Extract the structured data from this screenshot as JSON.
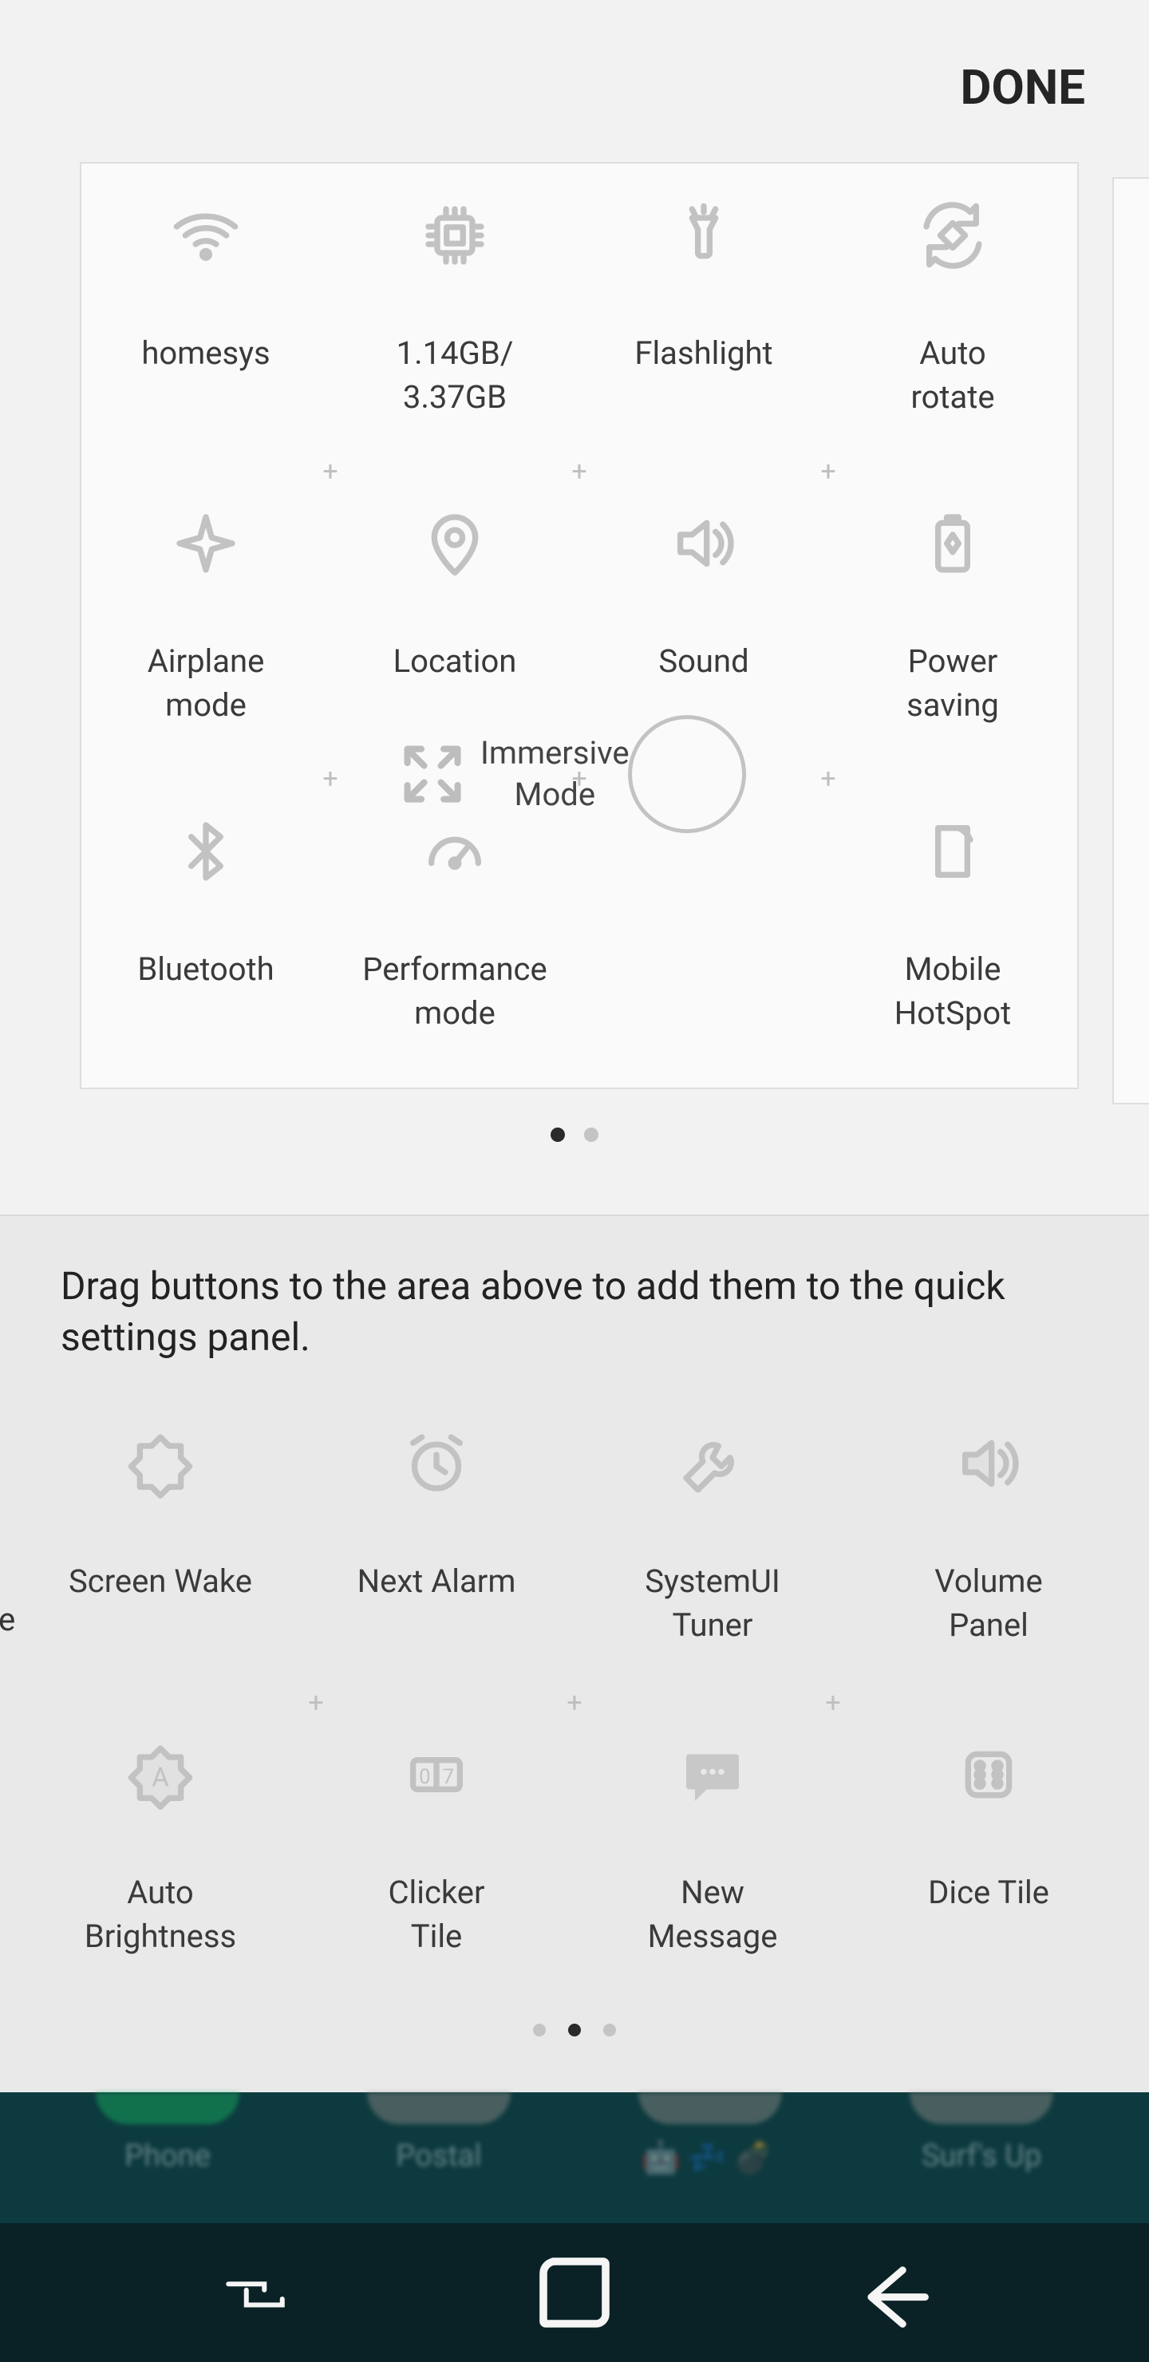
{
  "header": {
    "done": "DONE"
  },
  "top": {
    "tiles": [
      {
        "label": "homesys",
        "icon": "wifi-icon"
      },
      {
        "label": "1.14GB/\n3.37GB",
        "icon": "cpu-icon"
      },
      {
        "label": "Flashlight",
        "icon": "flashlight-icon"
      },
      {
        "label": "Auto\nrotate",
        "icon": "rotate-icon"
      },
      {
        "label": "Airplane\nmode",
        "icon": "airplane-icon"
      },
      {
        "label": "Location",
        "icon": "location-icon"
      },
      {
        "label": "Sound",
        "icon": "sound-icon"
      },
      {
        "label": "Power\nsaving",
        "icon": "battery-icon"
      },
      {
        "label": "Bluetooth",
        "icon": "bluetooth-icon"
      },
      {
        "label": "Performance\nmode",
        "icon": "gauge-icon"
      },
      {
        "label": "",
        "icon": "blank-icon"
      },
      {
        "label": "Mobile\nHotSpot",
        "icon": "hotspot-icon"
      }
    ],
    "immersive_label": "Immersive\nMode"
  },
  "page_dots_top": {
    "count": 2,
    "active": 0
  },
  "hint": "Drag buttons to the area above to add them to the quick settings panel.",
  "avail": {
    "left_cut_label": "e",
    "tiles": [
      {
        "label": "Screen Wake",
        "icon": "brightness-icon"
      },
      {
        "label": "Next Alarm",
        "icon": "alarm-icon"
      },
      {
        "label": "SystemUI\nTuner",
        "icon": "wrench-icon"
      },
      {
        "label": "Volume\nPanel",
        "icon": "volume-icon"
      },
      {
        "label": "Auto\nBrightness",
        "icon": "autobright-icon"
      },
      {
        "label": "Clicker\nTile",
        "icon": "counter-icon"
      },
      {
        "label": "New\nMessage",
        "icon": "message-icon"
      },
      {
        "label": "Dice Tile",
        "icon": "dice-icon"
      }
    ]
  },
  "page_dots_bottom": {
    "count": 3,
    "active": 1
  },
  "dock": {
    "items": [
      {
        "label": "Phone",
        "color": "#17b35f",
        "emoji": ""
      },
      {
        "label": "Postal",
        "color": "#8e8a86",
        "emoji": ""
      },
      {
        "label": "",
        "color": "#8e8a86",
        "emoji": "🤖💤💣"
      },
      {
        "label": "Surf's Up",
        "color": "#8e8a86",
        "emoji": ""
      }
    ]
  }
}
